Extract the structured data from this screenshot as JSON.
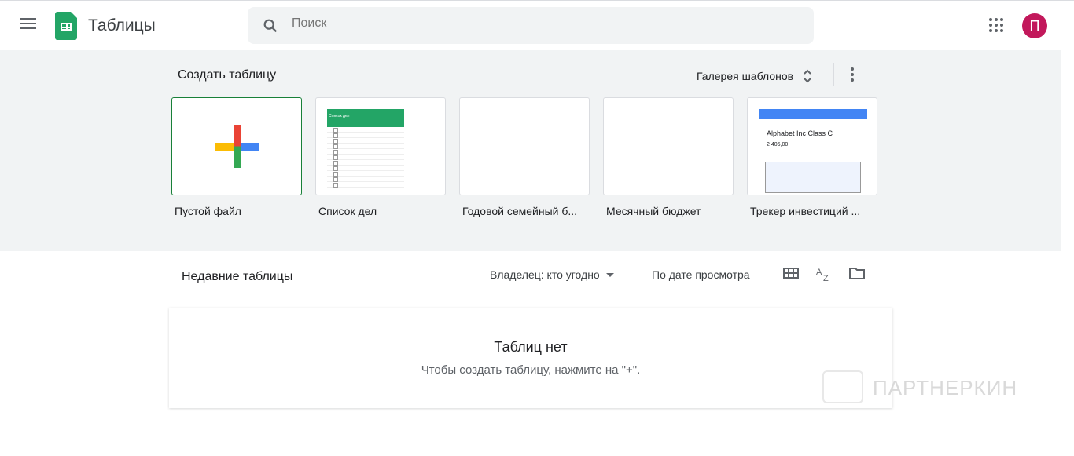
{
  "header": {
    "app_title": "Таблицы",
    "search_placeholder": "Поиск",
    "avatar_letter": "П"
  },
  "templates": {
    "create_label": "Создать таблицу",
    "gallery_label": "Галерея шаблонов",
    "items": [
      {
        "label": "Пустой файл"
      },
      {
        "label": "Список дел",
        "thumb_title": "Список дел"
      },
      {
        "label": "Годовой семейный б..."
      },
      {
        "label": "Месячный бюджет"
      },
      {
        "label": "Трекер инвестиций ...",
        "thumb_title": "Alphabet Inc Class C",
        "thumb_value": "2 405,00"
      }
    ]
  },
  "recent": {
    "title": "Недавние таблицы",
    "owner_filter": "Владелец: кто угодно",
    "sort": "По дате просмотра",
    "empty_title": "Таблиц нет",
    "empty_hint": "Чтобы создать таблицу, нажмите на \"+\"."
  },
  "watermark": "ПАРТНЕРКИН",
  "colors": {
    "accent": "#188038",
    "avatar": "#c2185b"
  }
}
